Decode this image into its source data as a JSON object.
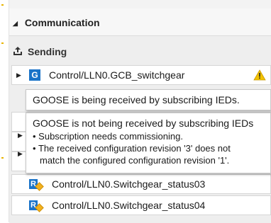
{
  "communication": {
    "title": "Communication",
    "sending": {
      "title": "Sending",
      "items": [
        {
          "label": "Control/LLN0.GCB_switchgear",
          "badge": "G",
          "warning": true
        },
        {
          "label": "Control/LLN0.Switchgear_status03",
          "badge": "R"
        },
        {
          "label": "Control/LLN0.Switchgear_status04",
          "badge": "R"
        }
      ]
    }
  },
  "tooltips": {
    "receiving": "GOOSE is being received by subscribing IEDs.",
    "not_receiving": {
      "title": "GOOSE is not being received by subscribing IEDs",
      "bullets": [
        "Subscription needs commissioning.",
        "The received configuration revision '3' does not"
      ],
      "continuation": "match the configured configuration revision '1'."
    }
  },
  "icons": {
    "expand": "expand-arrow-icon",
    "collapse": "collapse-arrow-icon",
    "upload": "upload-icon",
    "warning": "warning-icon"
  },
  "colors": {
    "badge_blue": "#1a73c8",
    "warning_yellow": "#f2c200",
    "accent_dot": "#e8b400"
  }
}
